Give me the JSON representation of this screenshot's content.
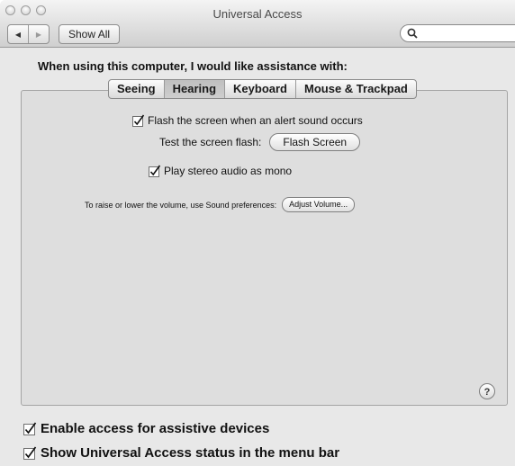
{
  "window": {
    "title": "Universal Access"
  },
  "toolbar": {
    "back_icon": "back-arrow-icon",
    "forward_icon": "forward-arrow-icon",
    "show_all_label": "Show All",
    "search_placeholder": "",
    "search_icon": "magnifier-icon"
  },
  "main": {
    "heading": "When using this computer, I would like assistance with:",
    "tabs": [
      {
        "label": "Seeing",
        "selected": false
      },
      {
        "label": "Hearing",
        "selected": true
      },
      {
        "label": "Keyboard",
        "selected": false
      },
      {
        "label": "Mouse & Trackpad",
        "selected": false
      }
    ]
  },
  "hearing": {
    "flash_screen": {
      "label": "Flash the screen when an alert sound occurs",
      "checked": true
    },
    "test_flash_label": "Test the screen flash:",
    "flash_button_label": "Flash Screen",
    "stereo_mono": {
      "label": "Play stereo audio as mono",
      "checked": true
    },
    "volume_text": "To raise or lower the volume, use Sound preferences:",
    "adjust_volume_label": "Adjust Volume...",
    "help_label": "?"
  },
  "footer": {
    "assistive_devices": {
      "label": "Enable access for assistive devices",
      "checked": true
    },
    "menu_bar_status": {
      "label": "Show Universal Access status in the menu bar",
      "checked": true
    }
  }
}
